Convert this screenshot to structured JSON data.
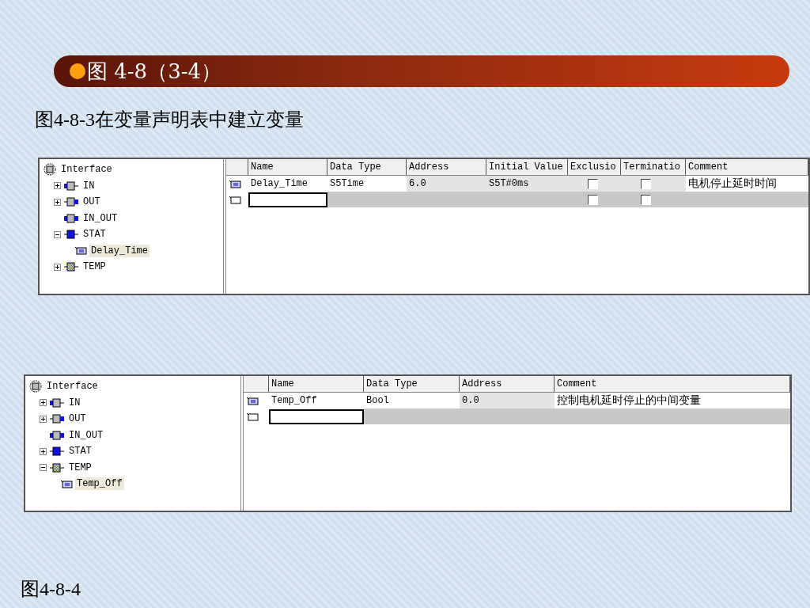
{
  "banner": {
    "title": "图 4-8（3-4）"
  },
  "caption": "图4-8-3在变量声明表中建立变量",
  "panels": [
    {
      "tree": [
        {
          "label": "Interface",
          "kind": "root",
          "selected": false,
          "children": [
            {
              "label": "IN",
              "kind": "in",
              "expanded": false,
              "selected": false
            },
            {
              "label": "OUT",
              "kind": "out",
              "expanded": false,
              "selected": false
            },
            {
              "label": "IN_OUT",
              "kind": "in_out",
              "selected": false
            },
            {
              "label": "STAT",
              "kind": "stat",
              "expanded": true,
              "selected": false,
              "children": [
                {
                  "label": "Delay_Time",
                  "kind": "var",
                  "selected": true
                }
              ]
            },
            {
              "label": "TEMP",
              "kind": "temp",
              "expanded": false,
              "selected": false
            }
          ]
        }
      ],
      "columns": [
        "Name",
        "Data Type",
        "Address",
        "Initial Value",
        "Exclusio",
        "Terminatio",
        "Comment"
      ],
      "rows": [
        {
          "kind": "variable",
          "cells": [
            {
              "kind": "text",
              "text": "Delay_Time"
            },
            {
              "kind": "text",
              "text": "S5Time"
            },
            {
              "kind": "text",
              "text": "6.0"
            },
            {
              "kind": "text",
              "text": "S5T#0ms"
            },
            {
              "kind": "checkbox",
              "checked": false
            },
            {
              "kind": "checkbox",
              "checked": false
            },
            {
              "kind": "text",
              "text": "电机停止延时时间"
            }
          ]
        },
        {
          "kind": "new",
          "cells": [
            {
              "kind": "input"
            },
            {
              "kind": "blank"
            },
            {
              "kind": "blank"
            },
            {
              "kind": "blank"
            },
            {
              "kind": "checkbox",
              "checked": false
            },
            {
              "kind": "checkbox",
              "checked": false
            },
            {
              "kind": "blank"
            }
          ]
        }
      ]
    },
    {
      "tree": [
        {
          "label": "Interface",
          "kind": "root",
          "selected": false,
          "children": [
            {
              "label": "IN",
              "kind": "in",
              "expanded": false,
              "selected": false
            },
            {
              "label": "OUT",
              "kind": "out",
              "expanded": false,
              "selected": false
            },
            {
              "label": "IN_OUT",
              "kind": "in_out",
              "selected": false
            },
            {
              "label": "STAT",
              "kind": "stat",
              "expanded": false,
              "selected": false
            },
            {
              "label": "TEMP",
              "kind": "temp",
              "expanded": true,
              "selected": false,
              "children": [
                {
                  "label": "Temp_Off",
                  "kind": "var",
                  "selected": true
                }
              ]
            }
          ]
        }
      ],
      "columns": [
        "Name",
        "Data Type",
        "Address",
        "Comment"
      ],
      "rows": [
        {
          "kind": "variable",
          "cells": [
            {
              "kind": "text",
              "text": "Temp_Off"
            },
            {
              "kind": "text",
              "text": "Bool"
            },
            {
              "kind": "text",
              "text": "0.0"
            },
            {
              "kind": "text",
              "text": "控制电机延时停止的中间变量"
            }
          ]
        },
        {
          "kind": "new",
          "cells": [
            {
              "kind": "input"
            },
            {
              "kind": "blank"
            },
            {
              "kind": "blank"
            },
            {
              "kind": "blank"
            }
          ]
        }
      ]
    }
  ],
  "footer_caption": "图4-8-4"
}
